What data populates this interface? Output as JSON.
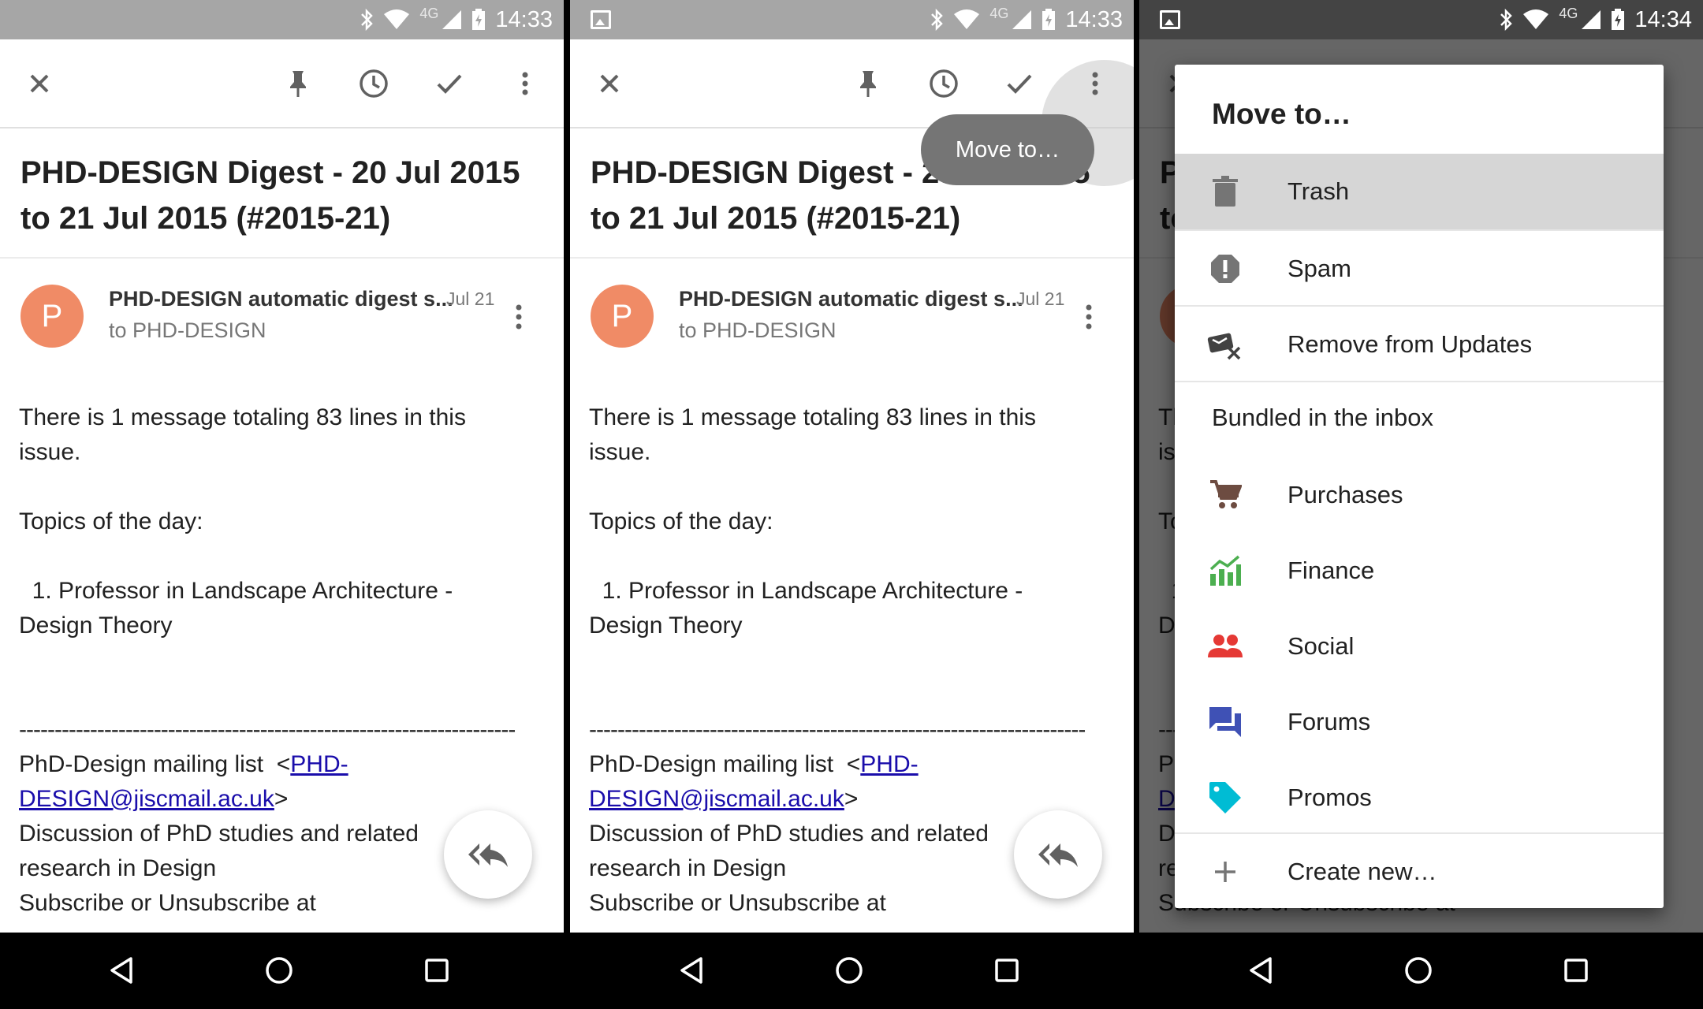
{
  "status": {
    "time_a": "14:33",
    "time_b": "14:34",
    "network": "4G"
  },
  "email": {
    "subject_line1": "PHD-DESIGN Digest - 20 Jul 2015",
    "subject_line2": "to 21 Jul 2015 (#2015-21)",
    "avatar_letter": "P",
    "sender": "PHD-DESIGN automatic digest s...",
    "date": "Jul 21",
    "to": "to PHD-DESIGN",
    "body_line1": "There is 1 message totaling 83 lines in this",
    "body_line2": "issue.",
    "topics": "Topics of the day:",
    "topic1_line1": "  1. Professor in Landscape Architecture -",
    "topic1_line2": "Design Theory",
    "dashes": "----------------------------------------------------------------------",
    "list_prefix": "PhD-Design mailing list  <",
    "list_link1": "PHD-",
    "list_link2": "DESIGN@jiscmail.ac.uk",
    "list_suffix": ">",
    "discussion_line1": "Discussion of PhD studies and related",
    "discussion_line2": "research in Design",
    "subscribe": "Subscribe or Unsubscribe at"
  },
  "tooltip": "Move to…",
  "dialog": {
    "title": "Move to…",
    "items": [
      {
        "label": "Trash",
        "icon": "trash-icon",
        "color": "#757575"
      },
      {
        "label": "Spam",
        "icon": "spam-icon",
        "color": "#757575"
      },
      {
        "label": "Remove from Updates",
        "icon": "remove-label-icon",
        "color": "#424242"
      }
    ],
    "section": "Bundled in the inbox",
    "bundles": [
      {
        "label": "Purchases",
        "icon": "cart-icon",
        "color": "#6d4c41"
      },
      {
        "label": "Finance",
        "icon": "finance-icon",
        "color": "#4caf50"
      },
      {
        "label": "Social",
        "icon": "social-icon",
        "color": "#e53935"
      },
      {
        "label": "Forums",
        "icon": "forums-icon",
        "color": "#3f51b5"
      },
      {
        "label": "Promos",
        "icon": "promos-icon",
        "color": "#00bcd4"
      }
    ],
    "create": "Create new…"
  }
}
